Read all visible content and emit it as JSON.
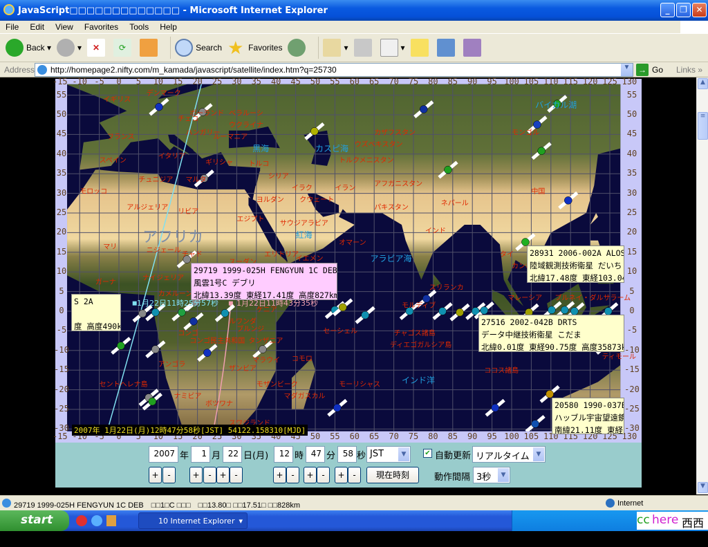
{
  "window": {
    "title": "JavaScript□□□□□□□□□□□□□ - Microsoft Internet Explorer"
  },
  "menu": [
    "File",
    "Edit",
    "View",
    "Favorites",
    "Tools",
    "Help"
  ],
  "toolbar": {
    "back": "Back",
    "search": "Search",
    "favorites": "Favorites"
  },
  "address": {
    "label": "Address",
    "url": "http://homepage2.nifty.com/m_kamada/javascript/satellite/index.htm?q=25730",
    "go": "Go",
    "links": "Links"
  },
  "map": {
    "lon_ticks": [
      "-15",
      "-10",
      "-5",
      "0",
      "5",
      "10",
      "15",
      "20",
      "25",
      "30",
      "35",
      "40",
      "45",
      "50",
      "55",
      "60",
      "65",
      "70",
      "75",
      "80",
      "85",
      "90",
      "95",
      "100",
      "105",
      "110",
      "115",
      "120",
      "125",
      "130"
    ],
    "lat_ticks": [
      "55",
      "50",
      "45",
      "40",
      "35",
      "30",
      "25",
      "20",
      "15",
      "10",
      "5",
      "0",
      "-5",
      "-10",
      "-15",
      "-20",
      "-25",
      "-30"
    ],
    "colors": {
      "ocean": "#0a0a3c",
      "grid": "#50506a",
      "desert": "#e6c48c",
      "forest": "#4f6430",
      "label": "#e02800",
      "sea_label": "#20a0e0"
    },
    "labels": [
      "デンマーク",
      "イギリス",
      "ポーランド",
      "ベラルーシ",
      "ウクライナ",
      "チェコ",
      "フランス",
      "スペイン",
      "イタリア",
      "ギリシャ",
      "黒海",
      "カスピ海",
      "トルコ",
      "チュニジア",
      "マルタ",
      "モロッコ",
      "アルジェリア",
      "リビア",
      "エジプト",
      "アフリカ",
      "サウジアラビア",
      "紅海",
      "イラク",
      "イラン",
      "マリ",
      "ニジェール",
      "チャド",
      "スーダン",
      "エチオピア",
      "オマーン",
      "アラビア海",
      "インド",
      "中国",
      "モンゴル",
      "カザフスタン",
      "ウズベキスタン",
      "トルクメニスタン",
      "アフガニスタン",
      "パキスタン",
      "ネパール",
      "タイ",
      "カンボジア",
      "マレーシア",
      "ブルネイ・ダルサラーム",
      "スリランカ",
      "モルディブ",
      "セーシェル",
      "インド洋",
      "コモロ",
      "マダガスカル",
      "モーリシャス",
      "コンゴ",
      "コンゴ民主共和国",
      "ケニア",
      "タンザニア",
      "アンゴラ",
      "ナミビア",
      "ボツワナ",
      "スワジランド",
      "セントヘレナ島",
      "チャゴス諸島",
      "ココス諸島",
      "ディエゴガルシア島",
      "ティモール",
      "バイカル湖",
      "ガーナ",
      "カメルーン",
      "ナイジェリア",
      "イエメン",
      "エリトリア",
      "クウェート",
      "ヨルダン",
      "シリア",
      "ルーマニア",
      "ハンガリー",
      "ブルンジ",
      "ルワンダ",
      "ザンビア",
      "モザンビーク",
      "マラウイ",
      "フィリピン"
    ],
    "satellites": [
      {
        "lon": 10.2,
        "lat": 52,
        "color": "#1030c0"
      },
      {
        "lon": 21.3,
        "lat": 50.7,
        "color": "#888888"
      },
      {
        "lon": 77.6,
        "lat": 51.4,
        "color": "#1030a0"
      },
      {
        "lon": 106.5,
        "lat": 47.5,
        "color": "#1840c0"
      },
      {
        "lon": 111.6,
        "lat": 52.8,
        "color": "#20a020"
      },
      {
        "lon": 107.6,
        "lat": 40.8,
        "color": "#20a020"
      },
      {
        "lon": 83.8,
        "lat": 36,
        "color": "#20a020"
      },
      {
        "lon": 49.8,
        "lat": 45.8,
        "color": "#b0b000"
      },
      {
        "lon": 21.7,
        "lat": 33.8,
        "color": "#888888"
      },
      {
        "lon": 114.4,
        "lat": 28.2,
        "color": "#1030c0"
      },
      {
        "lon": 17.3,
        "lat": 13.2,
        "color": "#888888"
      },
      {
        "lon": 103.5,
        "lat": 17.6,
        "color": "#20b020"
      },
      {
        "lon": -3.3,
        "lat": 0,
        "color": "#a0a000"
      },
      {
        "lon": 19.5,
        "lat": 2.3,
        "color": "#888888"
      },
      {
        "lon": 16,
        "lat": -0.3,
        "color": "#20a040"
      },
      {
        "lon": 9.3,
        "lat": -0.3,
        "color": "#1090b0"
      },
      {
        "lon": 6,
        "lat": -0.6,
        "color": "#888888"
      },
      {
        "lon": 19,
        "lat": -2.6,
        "color": "#1030a0"
      },
      {
        "lon": 22.5,
        "lat": -10.6,
        "color": "#1030c0"
      },
      {
        "lon": 0.5,
        "lat": -8.8,
        "color": "#20a020"
      },
      {
        "lon": 9.3,
        "lat": -9.7,
        "color": "#888888"
      },
      {
        "lon": 36.6,
        "lat": -9.7,
        "color": "#888888"
      },
      {
        "lon": 27,
        "lat": -0.5,
        "color": "#1090b0"
      },
      {
        "lon": 55,
        "lat": 0.3,
        "color": "#1090b0"
      },
      {
        "lon": 57,
        "lat": 1,
        "color": "#a0a000"
      },
      {
        "lon": 62.7,
        "lat": -1,
        "color": "#1090b0"
      },
      {
        "lon": 74,
        "lat": 0,
        "color": "#1090b0"
      },
      {
        "lon": 78.3,
        "lat": 3.2,
        "color": "#1030a0"
      },
      {
        "lon": 82.4,
        "lat": 0,
        "color": "#1090b0"
      },
      {
        "lon": 86.8,
        "lat": -0.3,
        "color": "#a0a000"
      },
      {
        "lon": 90.8,
        "lat": 0,
        "color": "#1090b0"
      },
      {
        "lon": 93,
        "lat": 0.2,
        "color": "#1090b0"
      },
      {
        "lon": 104.4,
        "lat": -0.3,
        "color": "#a0a000"
      },
      {
        "lon": 110.2,
        "lat": 0.3,
        "color": "#1090b0"
      },
      {
        "lon": 113.5,
        "lat": 0.3,
        "color": "#1090b0"
      },
      {
        "lon": 116,
        "lat": 0,
        "color": "#1090b0"
      },
      {
        "lon": 124.6,
        "lat": 0,
        "color": "#1090b0"
      },
      {
        "lon": 124,
        "lat": -8.8,
        "color": "#4010a0"
      },
      {
        "lon": 7.6,
        "lat": -22,
        "color": "#888888"
      },
      {
        "lon": 8.5,
        "lat": -23,
        "color": "#20a020"
      },
      {
        "lon": 55.6,
        "lat": -24.6,
        "color": "#1030c0"
      },
      {
        "lon": 95.8,
        "lat": -24.6,
        "color": "#1030c0"
      },
      {
        "lon": 109.7,
        "lat": -21.1,
        "color": "#c09000"
      },
      {
        "lon": 106,
        "lat": -28.7,
        "color": "#1050b0"
      }
    ],
    "tracks": [
      {
        "color": "#80e0f0",
        "label": "1月22日11時25分57秒"
      },
      {
        "color": "#f0a0b0",
        "label": "1月22日11時43分35秒"
      }
    ],
    "tooltips": [
      {
        "bg": "#ffccff",
        "lines": [
          "29719 1999-025H FENGYUN 1C DEB",
          "風雲1号C デブリ",
          "北緯13.39度 東経17.41度 高度827km"
        ]
      },
      {
        "bg": "#ffffcc",
        "lines": [
          "S 2A",
          "",
          "度 高度490km"
        ]
      },
      {
        "bg": "#ffffcc",
        "lines": [
          "28931 2006-002A ALOS",
          "陸域観測技術衛星 だいち",
          "北緯17.48度 東経103.04"
        ]
      },
      {
        "bg": "#ffffcc",
        "lines": [
          "27516 2002-042B DRTS",
          "データ中継技術衛星 こだま",
          "北緯0.01度 東経90.75度 高度35873km"
        ]
      },
      {
        "bg": "#ffffcc",
        "lines": [
          "20580 1990-037B",
          "ハッブル宇宙望遠鏡",
          "南緯21.11度 東経1"
        ]
      }
    ],
    "timestamp": "2007年 1月22日(月)12時47分58秒[JST] 54122.158310[MJD]"
  },
  "controls": {
    "year": "2007",
    "year_unit": "年",
    "month": "1",
    "month_unit": "月",
    "day": "22",
    "day_unit": "日(月)",
    "hour": "12",
    "hour_unit": "時",
    "minute": "47",
    "minute_unit": "分",
    "second": "58",
    "second_unit": "秒",
    "timezone": "JST",
    "auto_update_label": "自動更新",
    "auto_update_checked": true,
    "mode": "リアルタイム",
    "now_button": "現在時刻",
    "interval_label": "動作間隔",
    "interval": "3秒",
    "plus": "+",
    "minus": "-"
  },
  "status": {
    "text": "29719 1999-025H FENGYUN 1C DEB　□□1□C □□□　□□13.80□ □□17.51□ □□828km",
    "zone": "Internet"
  },
  "taskbar": {
    "start": "start",
    "ie_group": "10 Internet Explorer",
    "tray_text_1": "cc",
    "tray_text_2": "here",
    "tray_text_3": "西西河"
  }
}
